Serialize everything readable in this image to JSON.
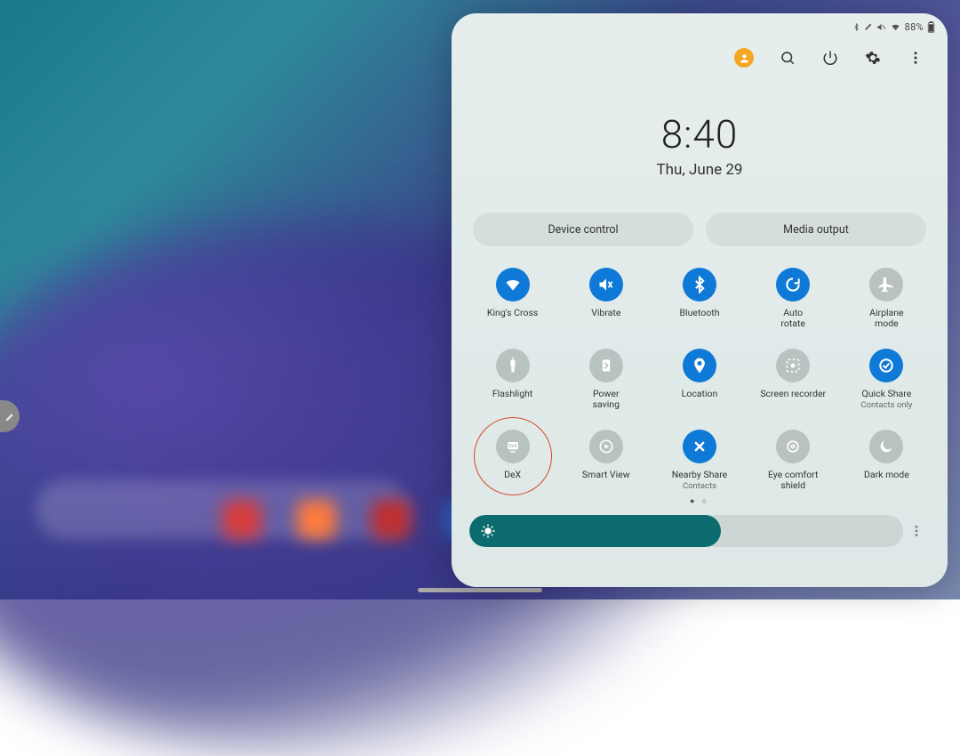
{
  "status_bar": {
    "battery_text": "88%",
    "icons": [
      "bluetooth",
      "stylus",
      "mute",
      "wifi"
    ]
  },
  "top_actions": {
    "avatar": "user-avatar",
    "search": "search",
    "power": "power",
    "settings": "settings",
    "more": "more"
  },
  "clock": {
    "time": "8:40",
    "date": "Thu, June 29"
  },
  "pills": {
    "device_control": "Device control",
    "media_output": "Media output"
  },
  "tiles": [
    {
      "id": "wifi",
      "label": "King's Cross",
      "sub": "",
      "active": true,
      "icon": "wifi"
    },
    {
      "id": "vibrate",
      "label": "Vibrate",
      "sub": "",
      "active": true,
      "icon": "vibrate"
    },
    {
      "id": "bluetooth",
      "label": "Bluetooth",
      "sub": "",
      "active": true,
      "icon": "bluetooth"
    },
    {
      "id": "autorotate",
      "label": "Auto\nrotate",
      "sub": "",
      "active": true,
      "icon": "rotate"
    },
    {
      "id": "airplane",
      "label": "Airplane\nmode",
      "sub": "",
      "active": false,
      "icon": "plane"
    },
    {
      "id": "flashlight",
      "label": "Flashlight",
      "sub": "",
      "active": false,
      "icon": "torch"
    },
    {
      "id": "powersaving",
      "label": "Power\nsaving",
      "sub": "",
      "active": false,
      "icon": "leaf"
    },
    {
      "id": "location",
      "label": "Location",
      "sub": "",
      "active": true,
      "icon": "pin"
    },
    {
      "id": "screenrecorder",
      "label": "Screen recorder",
      "sub": "",
      "active": false,
      "icon": "record"
    },
    {
      "id": "quickshare",
      "label": "Quick Share",
      "sub": "Contacts only",
      "active": true,
      "icon": "quickshare"
    },
    {
      "id": "dex",
      "label": "DeX",
      "sub": "",
      "active": false,
      "icon": "dex",
      "highlighted": true
    },
    {
      "id": "smartview",
      "label": "Smart View",
      "sub": "",
      "active": false,
      "icon": "cast"
    },
    {
      "id": "nearbyshare",
      "label": "Nearby Share",
      "sub": "Contacts",
      "active": true,
      "icon": "nearby"
    },
    {
      "id": "eyecomfort",
      "label": "Eye comfort\nshield",
      "sub": "",
      "active": false,
      "icon": "eye"
    },
    {
      "id": "darkmode",
      "label": "Dark mode",
      "sub": "",
      "active": false,
      "icon": "moon"
    }
  ],
  "pager": {
    "pages": 2,
    "current": 1
  },
  "brightness": {
    "percent": 58
  }
}
